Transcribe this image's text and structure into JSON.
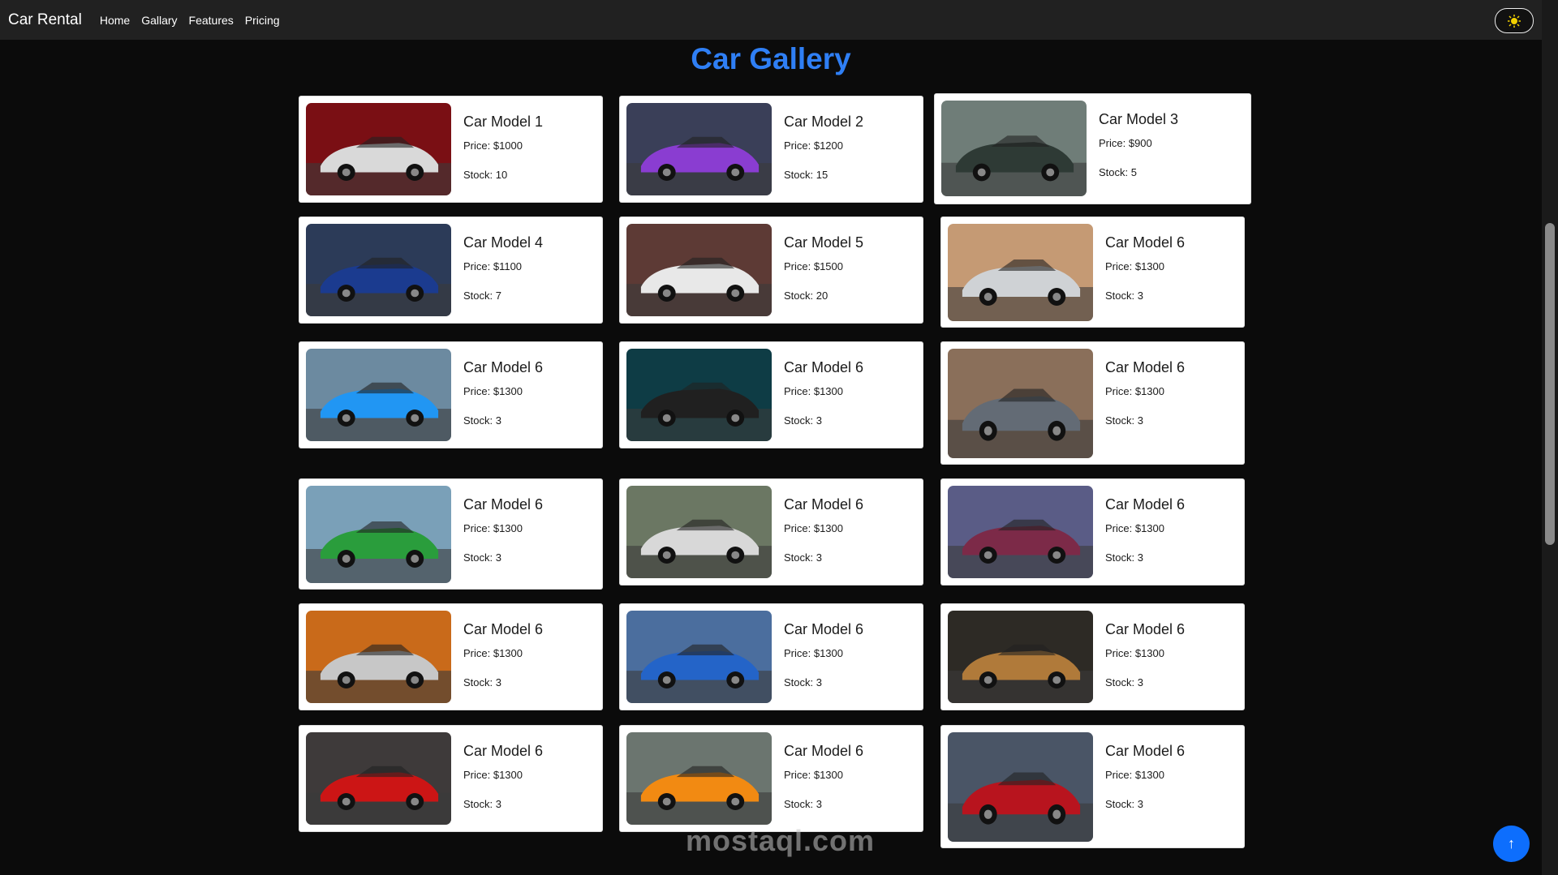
{
  "navbar": {
    "brand": "Car Rental",
    "links": [
      "Home",
      "Gallary",
      "Features",
      "Pricing"
    ],
    "theme_icon": "sun-icon"
  },
  "page": {
    "title": "Car Gallery"
  },
  "cars": [
    {
      "name": "Car Model 1",
      "price": "Price: $1000",
      "stock": "Stock: 10",
      "image": "white sports car on red stage"
    },
    {
      "name": "Car Model 2",
      "price": "Price: $1200",
      "stock": "Stock: 15",
      "image": "purple sedan"
    },
    {
      "name": "Car Model 3",
      "price": "Price: $900",
      "stock": "Stock: 5",
      "image": "classic green roadster"
    },
    {
      "name": "Car Model 4",
      "price": "Price: $1100",
      "stock": "Stock: 7",
      "image": "blue sports car"
    },
    {
      "name": "Car Model 5",
      "price": "Price: $1500",
      "stock": "Stock: 20",
      "image": "white sedan near building"
    },
    {
      "name": "Car Model 6",
      "price": "Price: $1300",
      "stock": "Stock: 3",
      "image": "white muscle car at dusk"
    },
    {
      "name": "Car Model 6",
      "price": "Price: $1300",
      "stock": "Stock: 3",
      "image": "blue sports car"
    },
    {
      "name": "Car Model 6",
      "price": "Price: $1300",
      "stock": "Stock: 3",
      "image": "electric car charging"
    },
    {
      "name": "Car Model 6",
      "price": "Price: $1300",
      "stock": "Stock: 3",
      "image": "grey sedan mountains"
    },
    {
      "name": "Car Model 6",
      "price": "Price: $1300",
      "stock": "Stock: 3",
      "image": "green race car"
    },
    {
      "name": "Car Model 6",
      "price": "Price: $1300",
      "stock": "Stock: 3",
      "image": "white hypercar"
    },
    {
      "name": "Car Model 6",
      "price": "Price: $1300",
      "stock": "Stock: 3",
      "image": "car with gull-wing doors"
    },
    {
      "name": "Car Model 6",
      "price": "Price: $1300",
      "stock": "Stock: 3",
      "image": "classic racing car"
    },
    {
      "name": "Car Model 6",
      "price": "Price: $1300",
      "stock": "Stock: 3",
      "image": "blue supercar"
    },
    {
      "name": "Car Model 6",
      "price": "Price: $1300",
      "stock": "Stock: 3",
      "image": "gold concept car"
    },
    {
      "name": "Car Model 6",
      "price": "Price: $1300",
      "stock": "Stock: 3",
      "image": "red supercar"
    },
    {
      "name": "Car Model 6",
      "price": "Price: $1300",
      "stock": "Stock: 3",
      "image": "orange supercar"
    },
    {
      "name": "Car Model 6",
      "price": "Price: $1300",
      "stock": "Stock: 3",
      "image": "red coupe"
    }
  ],
  "back_to_top_icon": "arrow-up-icon",
  "watermark": "mostaql.com",
  "colors": {
    "accent": "#2f7ff5",
    "navbar": "#212121",
    "button": "#0d6efd"
  }
}
